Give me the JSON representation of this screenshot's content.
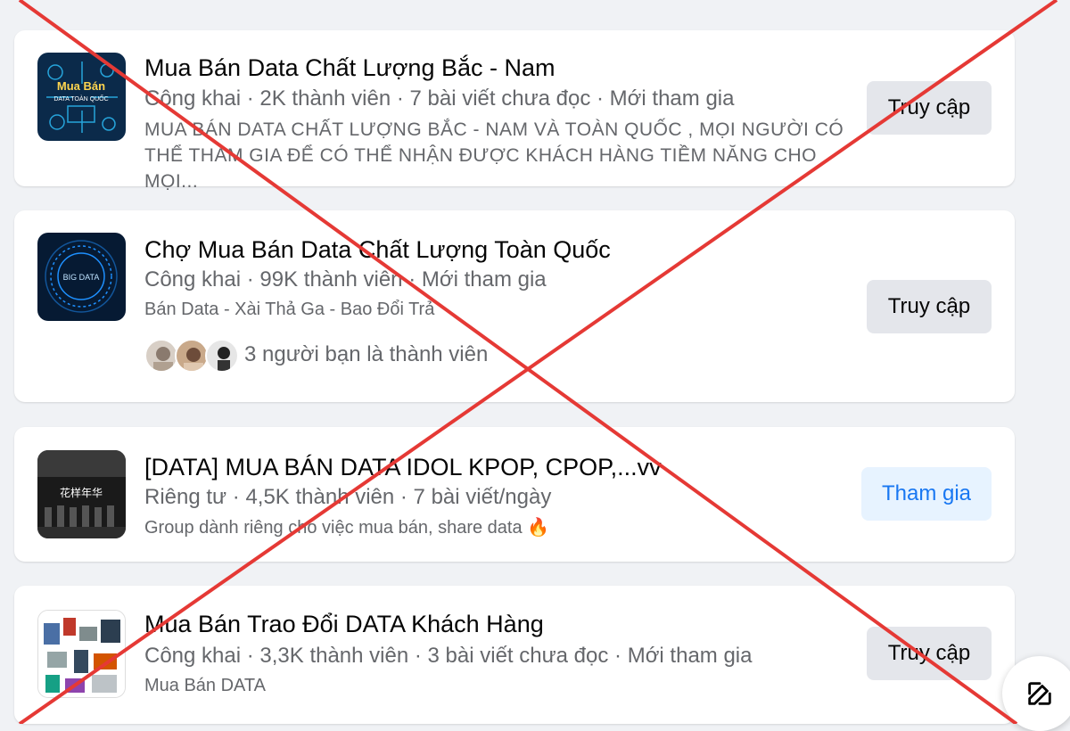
{
  "groups": [
    {
      "title": "Mua Bán Data Chất Lượng Bắc - Nam",
      "meta": "Công khai · 2K thành viên · 7 bài viết chưa đọc · Mới tham gia",
      "description": "MUA BÁN DATA CHẤT LƯỢNG BẮC - NAM VÀ TOÀN QUỐC , MỌI NGƯỜI CÓ THỂ THAM GIA ĐỂ CÓ THỂ NHẬN ĐƯỢC KHÁCH HÀNG TIỀM NĂNG CHO MỌI...",
      "button": "Truy cập",
      "thumb_text_top": "Mua Bán",
      "thumb_text_bottom": "DATA TOÀN QUỐC"
    },
    {
      "title": "Chợ Mua Bán Data Chất Lượng Toàn Quốc",
      "meta": "Công khai · 99K thành viên · Mới tham gia",
      "description": "Bán Data - Xài Thả Ga - Bao Đổi Trả",
      "friends": "3 người bạn là thành viên",
      "button": "Truy cập",
      "thumb_text": "BIG DATA"
    },
    {
      "title": "[DATA] MUA BÁN DATA IDOL KPOP, CPOP,...vv",
      "meta": "Riêng tư · 4,5K thành viên · 7 bài viết/ngày",
      "description": "Group dành riêng cho việc mua bán, share data 🔥",
      "button": "Tham gia",
      "thumb_text": "花样年华"
    },
    {
      "title": "Mua Bán Trao Đổi DATA Khách Hàng",
      "meta": "Công khai · 3,3K thành viên · 3 bài viết chưa đọc · Mới tham gia",
      "description": "Mua Bán DATA",
      "button": "Truy cập"
    }
  ],
  "fab": {
    "icon": "compose-icon"
  },
  "colors": {
    "cross": "#e53935",
    "join_text": "#1877f2",
    "join_bg": "#e7f3ff"
  }
}
